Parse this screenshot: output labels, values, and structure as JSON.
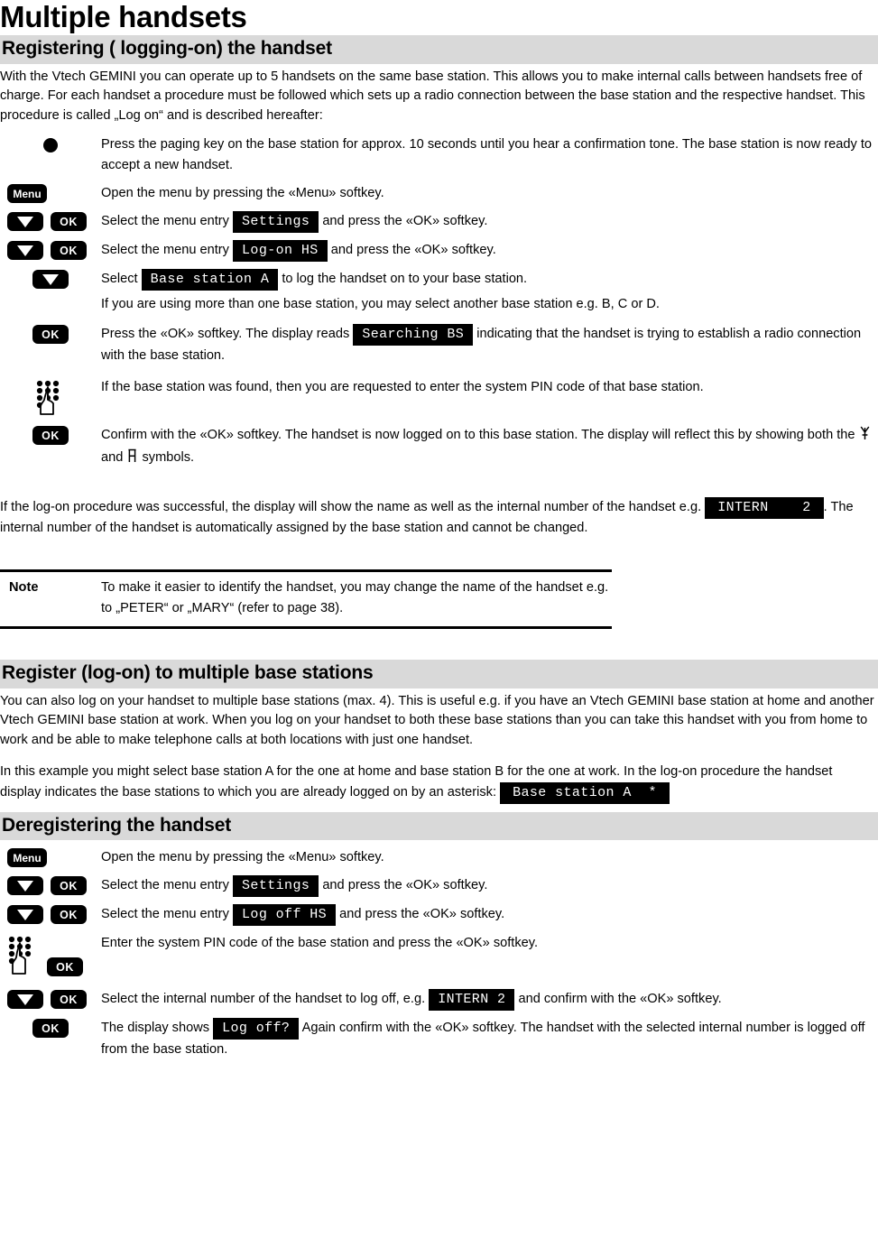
{
  "page": {
    "title": "Multiple handsets"
  },
  "sections": {
    "registering": {
      "heading": "Registering ( logging-on) the handset",
      "intro": "With the Vtech GEMINI you can operate up to 5 handsets on the same base station. This allows you to make internal calls between handsets free of charge. For each handset a procedure must be followed which sets up a radio connection between the base station and the respective handset. This procedure is called „Log on“ and is described hereafter:",
      "steps": [
        {
          "icon": "paging-key-bullet",
          "text": "Press the paging key on the base station for approx. 10 seconds until you hear a confirmation tone. The base station is now ready to accept a new handset."
        },
        {
          "icon": "menu-key",
          "text": "Open the menu by pressing the «Menu» softkey."
        },
        {
          "icon": "down-and-ok-keys",
          "text_before": "Select the menu entry",
          "display": "Settings",
          "text_after": "and press the «OK» softkey."
        },
        {
          "icon": "down-and-ok-keys",
          "text_before": "Select the menu entry",
          "display": "Log-on HS",
          "text_after": "and press the «OK» softkey."
        },
        {
          "icon": "down-key",
          "text_before": "Select",
          "display": "Base station A",
          "text_after": "to log the handset on to your base station.",
          "sub_text": "If you are using more than one base station, you may select another base station e.g. B, C or D."
        },
        {
          "icon": "ok-key",
          "text_before": "Press the «OK» softkey. The display reads",
          "display": "Searching BS",
          "text_after": "indicating that the handset is trying to establish a radio connection with the base station."
        },
        {
          "icon": "keypad-hand",
          "text": "If the base station was found, then you are requested to enter the system PIN code of that base station."
        },
        {
          "icon": "ok-key",
          "text_before": "Confirm with the «OK» softkey. The handset is now logged on to this base station. The display will reflect this by showing both the",
          "symbol_1": "antenna-symbol",
          "text_middle": "and",
          "symbol_2": "battery-symbol",
          "text_after": "symbols."
        }
      ],
      "closing_before": "If the log-on procedure was successful, the display will show the name as well as the internal number of the handset e.g.",
      "closing_display": "INTERN    2",
      "closing_after": ". The internal number of the handset is automatically assigned by the base station and cannot be changed."
    },
    "note": {
      "label": "Note",
      "text": "To make it easier to identify the handset, you may change the name of the handset e.g. to „PETER“ or „MARY“ (refer to page 38)."
    },
    "multiple_base": {
      "heading": "Register (log-on) to multiple base stations",
      "para_1": "You can also log on your handset to multiple base stations (max. 4). This is useful e.g. if you have an Vtech GEMINI base station at home and another Vtech GEMINI base station at work. When you log on your handset to both these base stations than you can take this handset with you from home to work and be able to make telephone calls at both locations with just one handset.",
      "para_2_before": "In this example you might select base station A for the one at home and base station B for the one at work. In the log-on procedure the handset display indicates the base stations to which you are already logged on by an asterisk:",
      "para_2_display": "Base station A  *"
    },
    "deregistering": {
      "heading": "Deregistering the handset",
      "steps": [
        {
          "icon": "menu-key",
          "text": "Open the menu by pressing the «Menu» softkey."
        },
        {
          "icon": "down-and-ok-keys",
          "text_before": "Select the menu entry",
          "display": "Settings",
          "text_after": "and press the «OK» softkey."
        },
        {
          "icon": "down-and-ok-keys",
          "text_before": "Select the menu entry",
          "display": "Log off HS",
          "text_after": "and press the «OK» softkey."
        },
        {
          "icon": "keypad-hand-and-ok",
          "text": "Enter the system PIN code of the base station and press the «OK» softkey."
        },
        {
          "icon": "down-and-ok-keys",
          "text_before": "Select the internal number of the handset to log off, e.g.",
          "display": "INTERN 2",
          "text_after": "and confirm with the «OK» softkey."
        },
        {
          "icon": "ok-key",
          "text_before": "The display shows",
          "display": "Log off?",
          "text_after": "Again confirm with the «OK» softkey. The handset with the selected internal number is logged off from the base station."
        }
      ]
    }
  },
  "keys": {
    "menu_label": "Menu",
    "ok_label": "OK"
  },
  "colors": {
    "section_band": "#d9d9d9",
    "display_bg": "#000000",
    "display_fg": "#ffffff"
  }
}
